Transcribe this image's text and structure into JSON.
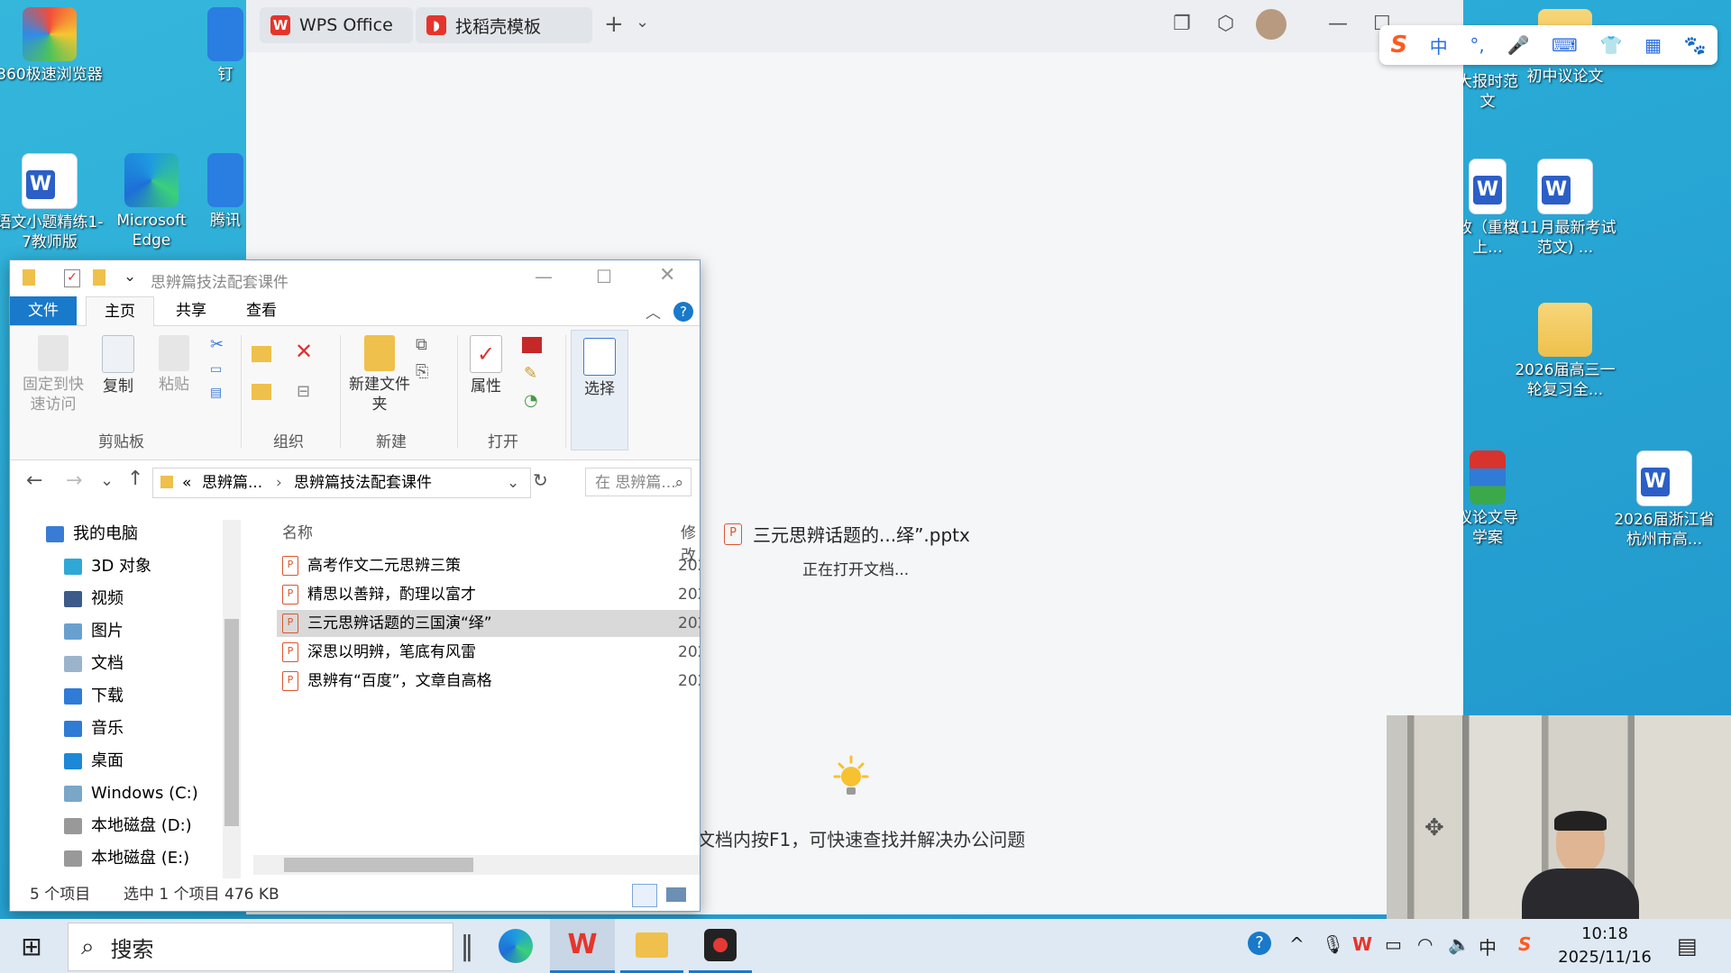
{
  "desktop": {
    "icons": [
      {
        "label": "360极速浏览器"
      },
      {
        "label": "钉"
      },
      {
        "label": "语文小题精练1-7教师版"
      },
      {
        "label": "Microsoft Edge"
      },
      {
        "label": "腾讯"
      },
      {
        "label": "大报时范文"
      },
      {
        "label": "初中议论文"
      },
      {
        "label": "改（重楼上..."
      },
      {
        "label": "(11月最新考试范文) ..."
      },
      {
        "label": "2026届高三一轮复习全..."
      },
      {
        "label": "议论文导学案"
      },
      {
        "label": "2026届浙江省杭州市高..."
      }
    ]
  },
  "wps": {
    "tabs": [
      {
        "label": "WPS Office"
      },
      {
        "label": "找稻壳模板"
      }
    ],
    "add_tab": "+",
    "tab_menu": "⌄",
    "loading": {
      "file_name": "三元思辨话题的...绎”.pptx",
      "status": "正在打开文档..."
    },
    "tip": "文档内按F1，可快速查找并解决办公问题"
  },
  "ime": {
    "items": [
      "S",
      "中",
      "°,",
      "🎤",
      "⌨",
      "👕",
      "▦",
      "🐾"
    ]
  },
  "explorer": {
    "title": "思辨篇技法配套课件",
    "menu": {
      "file": "文件",
      "home": "主页",
      "share": "共享",
      "view": "查看"
    },
    "ribbon": {
      "pin": "固定到快速访问",
      "copy": "复制",
      "paste": "粘贴",
      "new_folder": "新建文件夹",
      "properties": "属性",
      "select": "选择",
      "groups": {
        "clipboard": "剪贴板",
        "organize": "组织",
        "new": "新建",
        "open": "打开"
      }
    },
    "address": {
      "prefix": "«",
      "crumb1": "思辨篇...",
      "crumb2": "思辨篇技法配套课件",
      "search_placeholder": "在 思辨篇..."
    },
    "nav": [
      {
        "label": "我的电脑",
        "color": "#3a7bd5"
      },
      {
        "label": "3D 对象",
        "color": "#2fa8d8"
      },
      {
        "label": "视频",
        "color": "#3c5a8a"
      },
      {
        "label": "图片",
        "color": "#6aa0d0"
      },
      {
        "label": "文档",
        "color": "#9bb4cc"
      },
      {
        "label": "下载",
        "color": "#2f7bd6"
      },
      {
        "label": "音乐",
        "color": "#2f7bd6"
      },
      {
        "label": "桌面",
        "color": "#1e88d8"
      },
      {
        "label": "Windows  (C:)",
        "color": "#7aa6c8"
      },
      {
        "label": "本地磁盘 (D:)",
        "color": "#999999"
      },
      {
        "label": "本地磁盘 (E:)",
        "color": "#999999"
      }
    ],
    "columns": {
      "name": "名称",
      "modified": "修改"
    },
    "files": [
      {
        "name": "高考作文二元思辨三策",
        "date": "202"
      },
      {
        "name": "精思以善辩，酌理以富才",
        "date": "202"
      },
      {
        "name": "三元思辨话题的三国演“绎”",
        "date": "202"
      },
      {
        "name": "深思以明辨，笔底有风雷",
        "date": "202"
      },
      {
        "name": "思辨有“百度”，文章自高格",
        "date": "202"
      }
    ],
    "status": {
      "count": "5 个项目",
      "selected": "选中 1 个项目  476 KB"
    }
  },
  "taskbar": {
    "search": "搜索",
    "ime_indicator": "中",
    "time": "10:18",
    "date": "2025/11/16"
  },
  "colors": {
    "accent": "#1979ca",
    "wps_red": "#e5352b",
    "selection": "#d9d9d9"
  }
}
